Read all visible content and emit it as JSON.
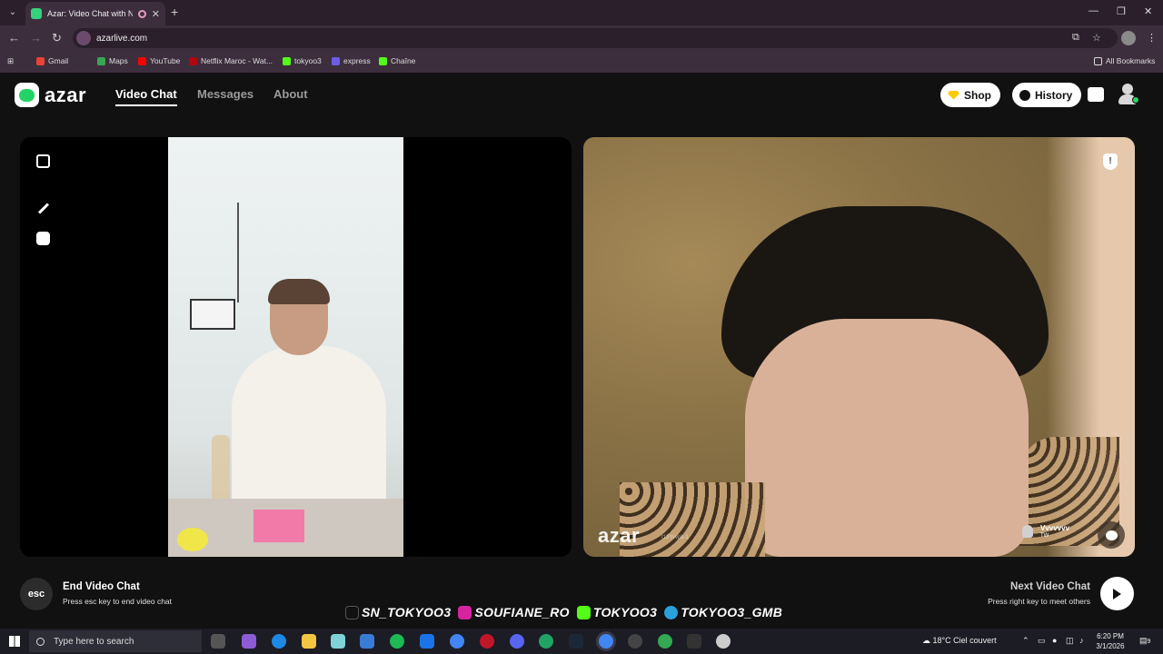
{
  "browser": {
    "tab_title": "Azar: Video Chat with New",
    "url": "azarlive.com",
    "bookmarks": [
      "Gmail",
      "Maps",
      "YouTube",
      "Netflix Maroc - Wat...",
      "tokyoo3",
      "express",
      "Chaîne"
    ],
    "all_bookmarks": "All Bookmarks"
  },
  "header": {
    "logo_text": "azar",
    "nav": [
      "Video Chat",
      "Messages",
      "About"
    ],
    "shop_label": "Shop",
    "history_label": "History"
  },
  "peer": {
    "watermark": "azar",
    "watermark_id": "t13Yvvpk-1",
    "name": "Vvvvvvv",
    "country": "TW"
  },
  "controls": {
    "esc_key": "esc",
    "end_title": "End Video Chat",
    "end_hint": "Press esc key to end video chat",
    "next_title": "Next Video Chat",
    "next_hint": "Press right key to meet others"
  },
  "socials": [
    "SN_TOKYOO3",
    "SOUFIANE_RO",
    "TOKYOO3",
    "TOKYOO3_GMB"
  ],
  "taskbar": {
    "search_placeholder": "Type here to search",
    "weather": "18°C  Ciel couvert",
    "time": "6:20 PM",
    "date": "3/1/2026",
    "notifications": "9"
  },
  "colors": {
    "azar_green": "#24d366",
    "shop_gem": "#ffcc00",
    "page_bg": "#111111"
  }
}
